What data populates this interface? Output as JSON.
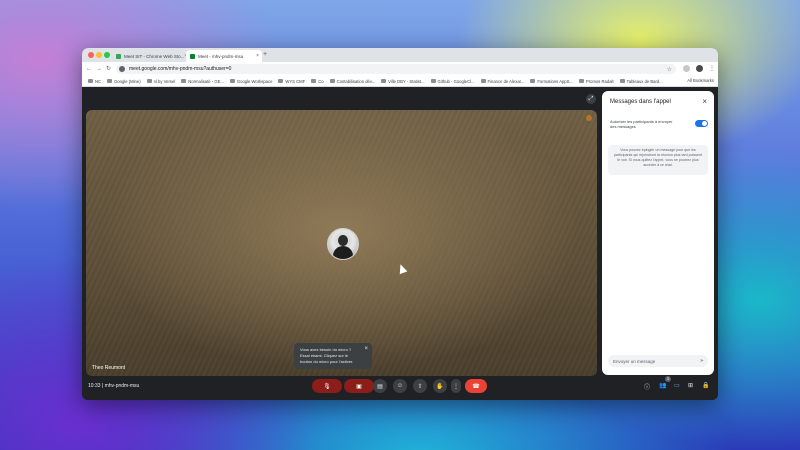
{
  "browser": {
    "tabs": [
      {
        "title": "Meet SIT - Chrome Web Sto..."
      },
      {
        "title": "Meet - mhv-pndm-msu"
      }
    ],
    "address": "meet.google.com/mhv-pndm-msu?authuser=0",
    "bookmarks": [
      "NC",
      "Google (Mine)",
      "nl by Versel",
      "Normalisaté - GE...",
      "Google Workspace",
      "WYS CMF",
      "Co",
      "Contabilisation dév...",
      "Ville DBY - Statist...",
      "Github - GoogleCl...",
      "Finance de Alexar...",
      "Formations AppS...",
      "Promos Radalt",
      "Tableaux de Bard..."
    ],
    "all_bookmarks": "All Bookmarks"
  },
  "meet": {
    "participant_name": "Theo Reumont",
    "toast": {
      "text": "Vous avez besoin du micro ? Essai ekami. Cliquez sur le bouton du micro pour l'activer."
    },
    "time": "10:33",
    "meeting_code": "mhv-pndm-msu",
    "people_count": "3",
    "panel": {
      "title": "Messages dans l'appel",
      "toggle_label": "Autoriser les participants à envoyer des messages",
      "toggle_on": true,
      "info": "Vous pouvez épingler un message pour que les participants qui rejoindront la réunion plus tard puissent le voir. Si vous quittez l'appel, vous ne pourrez plus accéder à ce chat.",
      "input_placeholder": "Envoyer un message"
    }
  },
  "colors": {
    "accent": "#1a73e8",
    "end_call": "#ea4335",
    "muted": "#8c1d18",
    "meet_bg": "#202124"
  },
  "icons": {
    "mic_off": "mic-off-icon",
    "cam_off": "camera-off-icon",
    "captions": "captions-icon",
    "emoji": "emoji-icon",
    "present": "present-icon",
    "hand": "raise-hand-icon",
    "more": "more-vert-icon",
    "end": "end-call-icon"
  }
}
